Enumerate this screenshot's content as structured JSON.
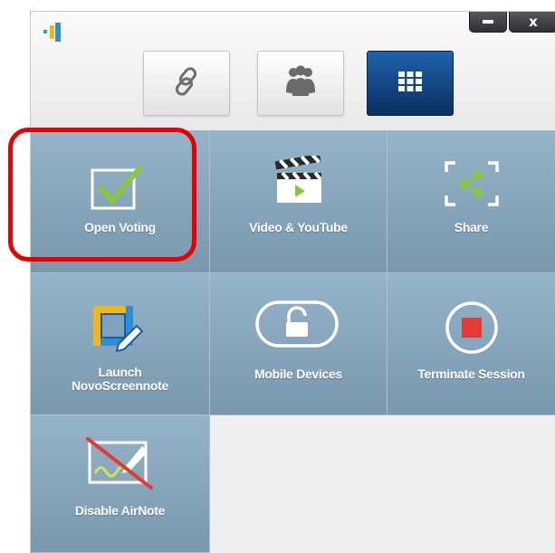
{
  "window": {
    "title_logo": "novo-logo-icon",
    "controls": {
      "minimize": "minimize-icon",
      "close_label": "x"
    }
  },
  "modes": [
    {
      "name": "link",
      "icon": "link-icon",
      "active": false
    },
    {
      "name": "participants",
      "icon": "people-icon",
      "active": false
    },
    {
      "name": "apps",
      "icon": "grid-icon",
      "active": true
    }
  ],
  "tiles": {
    "open_voting": {
      "label": "Open Voting",
      "icon": "voting-check-icon"
    },
    "video_youtube": {
      "label": "Video & YouTube",
      "icon": "clapperboard-icon"
    },
    "share": {
      "label": "Share",
      "icon": "share-icon"
    },
    "launch_screennote": {
      "label_line1": "Launch",
      "label_line2": "NovoScreennote",
      "icon": "screennote-icon"
    },
    "mobile_devices": {
      "label": "Mobile Devices",
      "icon": "unlock-icon"
    },
    "terminate_session": {
      "label": "Terminate Session",
      "icon": "stop-icon"
    },
    "disable_airnote": {
      "label": "Disable AirNote",
      "icon": "airnote-disabled-icon"
    }
  },
  "colors": {
    "tile": "#8aa8be",
    "active_mode": "#0f3e74",
    "highlight": "#e40000",
    "check": "#8cc63f",
    "stop": "#e53935"
  }
}
